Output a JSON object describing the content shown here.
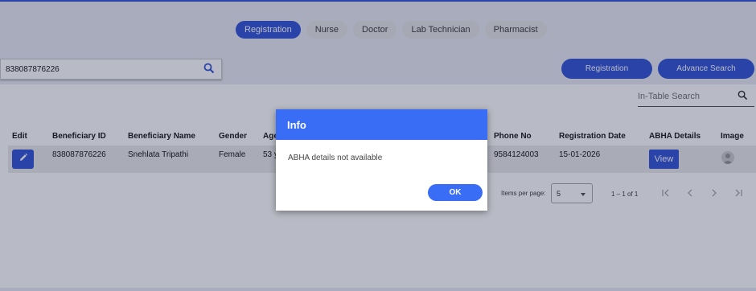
{
  "tabs": [
    {
      "label": "Registration",
      "active": true
    },
    {
      "label": "Nurse",
      "active": false
    },
    {
      "label": "Doctor",
      "active": false
    },
    {
      "label": "Lab Technician",
      "active": false
    },
    {
      "label": "Pharmacist",
      "active": false
    }
  ],
  "search": {
    "value": "838087876226"
  },
  "actions": {
    "registration_label": "Registration",
    "advance_search_label": "Advance Search"
  },
  "table": {
    "in_table_search_placeholder": "In-Table Search",
    "columns": [
      "Edit",
      "Beneficiary ID",
      "Beneficiary Name",
      "Gender",
      "Age",
      "Phone No",
      "Registration Date",
      "ABHA Details",
      "Image"
    ],
    "row": {
      "beneficiary_id": "838087876226",
      "name": "Snehlata Tripathi",
      "gender": "Female",
      "age": "53 y",
      "phone": "9584124003",
      "reg_date": "15-01-2026",
      "view_label": "View"
    }
  },
  "pagination": {
    "items_per_page_label": "Items per page:",
    "page_size": "5",
    "range": "1 – 1 of 1"
  },
  "dialog": {
    "title": "Info",
    "message": "ABHA details not available",
    "ok_label": "OK"
  },
  "colors": {
    "primary": "#3a5bd9",
    "dialog_header": "#3a6df5"
  },
  "icons": [
    "search-icon",
    "edit-icon",
    "avatar-icon",
    "first-page-icon",
    "prev-page-icon",
    "next-page-icon",
    "last-page-icon"
  ]
}
